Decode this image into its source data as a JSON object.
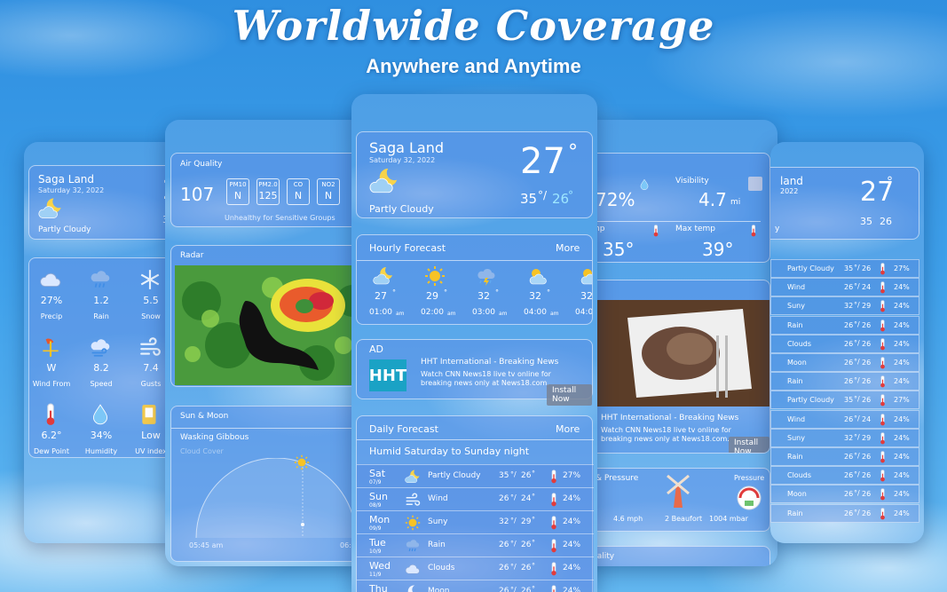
{
  "hero": {
    "title": "Worldwide Coverage",
    "subtitle": "Anywhere and Anytime"
  },
  "colors": {
    "sky": "#3ea0ea",
    "card": "#5a8ce6",
    "accent": "#9ee7ff",
    "hht_logo": "#1aa2c5",
    "sun": "#f7c325"
  },
  "location": {
    "name": "Saga Land",
    "date": "Saturday 32, 2022",
    "condition": "Partly Cloudy",
    "temp": "27",
    "deg": "°",
    "high": "35",
    "low": "26",
    "condition_icon": "moon-cloud-icon"
  },
  "details": [
    {
      "value": "27%",
      "label": "Precip",
      "icon": "cloud-icon"
    },
    {
      "value": "1.2",
      "label": "Rain",
      "icon": "rain-cloud-icon"
    },
    {
      "value": "5.5",
      "label": "Snow",
      "icon": "snowflake-icon"
    },
    {
      "value": "W",
      "label": "Wind From",
      "icon": "weathervane-icon"
    },
    {
      "value": "8.2",
      "label": "Speed",
      "icon": "wind-cloud-icon"
    },
    {
      "value": "7.4",
      "label": "Gusts",
      "icon": "wind-icon"
    },
    {
      "value": "6.2°",
      "label": "Dew Point",
      "icon": "thermometer-icon"
    },
    {
      "value": "34%",
      "label": "Humidity",
      "icon": "droplet-icon"
    },
    {
      "value": "Low",
      "label": "UV index",
      "icon": "uv-icon"
    }
  ],
  "air": {
    "title": "Air Quality",
    "aqi": "107",
    "status": "Unhealthy for Sensitive Groups",
    "pollutants": [
      {
        "name": "PM10",
        "value": "N"
      },
      {
        "name": "PM2.0",
        "value": "125"
      },
      {
        "name": "CO",
        "value": "N"
      },
      {
        "name": "NO2",
        "value": "N"
      }
    ]
  },
  "radar": {
    "title": "Radar"
  },
  "sunmoon": {
    "title": "Sun & Moon",
    "phase": "Wasking Gibbous",
    "cloud_cover": "Cloud Cover",
    "sunrise": "05:45 am",
    "sunset": "06:3"
  },
  "hourly": {
    "title": "Hourly Forecast",
    "more": "More",
    "unit_am": "am",
    "items": [
      {
        "temp": "27",
        "time": "01:00",
        "icon": "moon-cloud-icon"
      },
      {
        "temp": "29",
        "time": "02:00",
        "icon": "sun-icon"
      },
      {
        "temp": "32",
        "time": "03:00",
        "icon": "storm-icon"
      },
      {
        "temp": "32",
        "time": "04:00",
        "icon": "sun-cloud-icon"
      },
      {
        "temp": "32",
        "time": "04:00",
        "icon": "sun-cloud-icon"
      }
    ]
  },
  "ad": {
    "label": "AD",
    "logo": "HHT",
    "title": "HHT International - Breaking News",
    "body1": "Watch CNN News18 live tv online for",
    "body2": "breaking news only at News18.com.",
    "button": "Install Now"
  },
  "daily": {
    "title": "Daily Forecast",
    "more": "More",
    "summary": "Humid Saturday to Sunday night",
    "rows": [
      {
        "day": "Sat",
        "date": "07/9",
        "cond": "Partly Cloudy",
        "hi": "35",
        "lo": "26",
        "precip": "27%",
        "icon": "moon-cloud-icon"
      },
      {
        "day": "Sun",
        "date": "08/9",
        "cond": "Wind",
        "hi": "26",
        "lo": "24",
        "precip": "24%",
        "icon": "wind-icon"
      },
      {
        "day": "Mon",
        "date": "09/9",
        "cond": "Suny",
        "hi": "32",
        "lo": "29",
        "precip": "24%",
        "icon": "sun-icon"
      },
      {
        "day": "Tue",
        "date": "10/9",
        "cond": "Rain",
        "hi": "26",
        "lo": "26",
        "precip": "24%",
        "icon": "rain-icon"
      },
      {
        "day": "Wed",
        "date": "11/9",
        "cond": "Clouds",
        "hi": "26",
        "lo": "26",
        "precip": "24%",
        "icon": "cloud-icon"
      },
      {
        "day": "Thu",
        "date": "12/9",
        "cond": "Moon",
        "hi": "26",
        "lo": "26",
        "precip": "24%",
        "icon": "moon-icon"
      }
    ]
  },
  "phone4": {
    "humidity_label": "s",
    "humidity": "72%",
    "visibility_label": "Visibility",
    "visibility": "4.7",
    "visibility_unit": "mi",
    "temp_label": "mp",
    "temp_val": "35°",
    "maxtemp_label": "Max temp",
    "maxtemp": "39°",
    "wind_title": "& Pressure",
    "wind_speed": "4.6 mph",
    "beaufort": "2 Beaufort",
    "pressure_label": "Pressure",
    "pressure": "1004 mbar",
    "bottom": "uality"
  },
  "phone5": {
    "rows": [
      {
        "cond": "Partly Cloudy",
        "hi": "35",
        "lo": "26",
        "precip": "27%"
      },
      {
        "cond": "Wind",
        "hi": "26",
        "lo": "24",
        "precip": "24%"
      },
      {
        "cond": "Suny",
        "hi": "32",
        "lo": "29",
        "precip": "24%"
      },
      {
        "cond": "Rain",
        "hi": "26",
        "lo": "26",
        "precip": "24%"
      },
      {
        "cond": "Clouds",
        "hi": "26",
        "lo": "26",
        "precip": "24%"
      },
      {
        "cond": "Moon",
        "hi": "26",
        "lo": "26",
        "precip": "24%"
      },
      {
        "cond": "Rain",
        "hi": "26",
        "lo": "26",
        "precip": "24%"
      },
      {
        "cond": "Partly Cloudy",
        "hi": "35",
        "lo": "26",
        "precip": "27%"
      },
      {
        "cond": "Wind",
        "hi": "26",
        "lo": "24",
        "precip": "24%"
      },
      {
        "cond": "Suny",
        "hi": "32",
        "lo": "29",
        "precip": "24%"
      },
      {
        "cond": "Rain",
        "hi": "26",
        "lo": "26",
        "precip": "24%"
      },
      {
        "cond": "Clouds",
        "hi": "26",
        "lo": "26",
        "precip": "24%"
      },
      {
        "cond": "Moon",
        "hi": "26",
        "lo": "26",
        "precip": "24%"
      },
      {
        "cond": "Rain",
        "hi": "26",
        "lo": "26",
        "precip": "24%"
      }
    ]
  }
}
